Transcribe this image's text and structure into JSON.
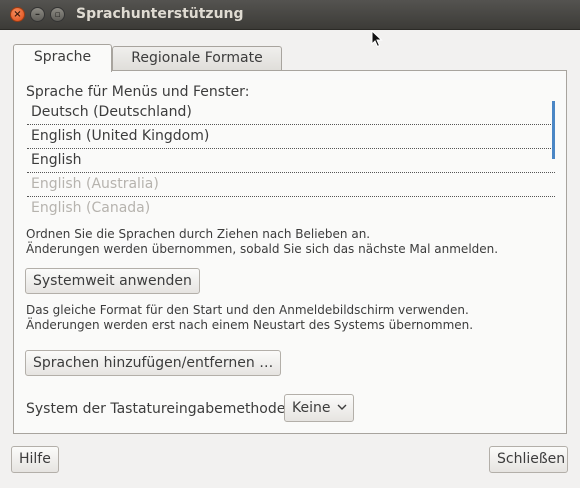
{
  "window": {
    "title": "Sprachunterstützung",
    "close_glyph": "×",
    "minimize_glyph": "–",
    "maximize_glyph": "▫"
  },
  "tabs": [
    {
      "label": "Sprache",
      "active": true
    },
    {
      "label": "Regionale Formate",
      "active": false
    }
  ],
  "language_section": {
    "label": "Sprache für Menüs und Fenster:",
    "languages": [
      {
        "label": "Deutsch (Deutschland)",
        "enabled": true
      },
      {
        "label": "English (United Kingdom)",
        "enabled": true
      },
      {
        "label": "English",
        "enabled": true
      },
      {
        "label": "English (Australia)",
        "enabled": false
      },
      {
        "label": "English (Canada)",
        "enabled": false
      }
    ],
    "hint_line1": "Ordnen Sie die Sprachen durch Ziehen nach Belieben an.",
    "hint_line2": "Änderungen werden übernommen, sobald Sie sich das nächste Mal anmelden."
  },
  "system_wide": {
    "button_label": "Systemweit anwenden",
    "hint_line1": "Das gleiche Format für den Start und den Anmeldebildschirm verwenden.",
    "hint_line2": "Änderungen werden erst nach einem Neustart des Systems übernommen."
  },
  "add_remove_button_label": "Sprachen hinzufügen/entfernen …",
  "keyboard_input": {
    "label": "System der Tastatureingabemethode:",
    "selected": "Keine"
  },
  "footer": {
    "help_label": "Hilfe",
    "close_label": "Schließen"
  },
  "colors": {
    "titlebar": "#3c3b37",
    "window_bg": "#f2f1f0",
    "accent": "#4a86c5",
    "close_button": "#df4a16"
  }
}
